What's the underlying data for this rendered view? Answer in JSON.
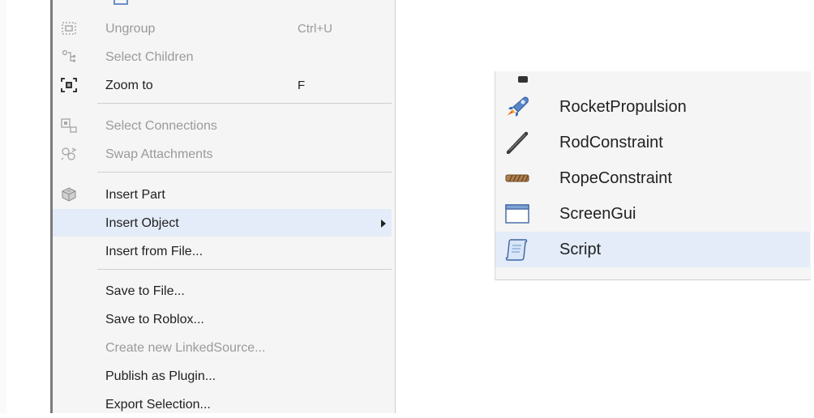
{
  "context_menu": {
    "items": [
      {
        "label": "Ungroup",
        "shortcut": "Ctrl+U",
        "icon": "ungroup-icon",
        "disabled": true
      },
      {
        "label": "Select Children",
        "shortcut": "",
        "icon": "select-children-icon",
        "disabled": true
      },
      {
        "label": "Zoom to",
        "shortcut": "F",
        "icon": "zoom-to-icon",
        "disabled": false
      },
      {
        "label": "Select Connections",
        "shortcut": "",
        "icon": "select-connections-icon",
        "disabled": true
      },
      {
        "label": "Swap Attachments",
        "shortcut": "",
        "icon": "swap-attachments-icon",
        "disabled": true
      },
      {
        "label": "Insert Part",
        "shortcut": "",
        "icon": "part-icon",
        "disabled": false
      },
      {
        "label": "Insert Object",
        "shortcut": "",
        "icon": "",
        "disabled": false,
        "highlighted": true,
        "submenu": true
      },
      {
        "label": "Insert from File...",
        "shortcut": "",
        "icon": "",
        "disabled": false
      },
      {
        "label": "Save to File...",
        "shortcut": "",
        "icon": "",
        "disabled": false
      },
      {
        "label": "Save to Roblox...",
        "shortcut": "",
        "icon": "",
        "disabled": false
      },
      {
        "label": "Create new LinkedSource...",
        "shortcut": "",
        "icon": "",
        "disabled": true
      },
      {
        "label": "Publish as Plugin...",
        "shortcut": "",
        "icon": "",
        "disabled": false
      },
      {
        "label": "Export Selection...",
        "shortcut": "",
        "icon": "",
        "disabled": false
      }
    ]
  },
  "insert_object_submenu": {
    "items": [
      {
        "label": "RocketPropulsion",
        "icon": "rocket-icon"
      },
      {
        "label": "RodConstraint",
        "icon": "rod-constraint-icon"
      },
      {
        "label": "RopeConstraint",
        "icon": "rope-constraint-icon"
      },
      {
        "label": "ScreenGui",
        "icon": "screen-gui-icon"
      },
      {
        "label": "Script",
        "icon": "script-icon",
        "highlighted": true
      }
    ]
  },
  "colors": {
    "menu_background": "#f5f5f5",
    "highlight": "#e3ecf8",
    "disabled_text": "#9a9a9a",
    "text": "#1f1f1f"
  }
}
